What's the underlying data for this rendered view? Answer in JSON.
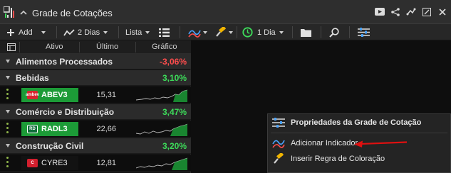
{
  "window": {
    "title": "Grade de Cotações"
  },
  "toolbar": {
    "add_label": "Add",
    "period_label": "2 Dias",
    "view_label": "Lista",
    "interval_label": "1 Dia"
  },
  "grid": {
    "columns": [
      "Ativo",
      "Último",
      "Gráfico"
    ],
    "groups": [
      {
        "name": "Alimentos Processados",
        "change": "-3,06%",
        "color": "#ff4d4d",
        "rows": []
      },
      {
        "name": "Bebidas",
        "change": "3,10%",
        "color": "#3ddc5a",
        "rows": [
          {
            "ticker": "ABEV3",
            "price": "15,31",
            "logo_text": "ambev",
            "logo_color": "#d8262f",
            "highlight": true
          }
        ]
      },
      {
        "name": "Comércio e Distribuição",
        "change": "3,47%",
        "color": "#3ddc5a",
        "rows": [
          {
            "ticker": "RADL3",
            "price": "22,66",
            "logo_text": "RD",
            "logo_color": "#0e6e3a",
            "highlight": true
          }
        ]
      },
      {
        "name": "Construção Civil",
        "change": "3,20%",
        "color": "#3ddc5a",
        "rows": [
          {
            "ticker": "CYRE3",
            "price": "12,81",
            "logo_text": "C",
            "logo_color": "#d31f2e",
            "highlight": false
          }
        ]
      }
    ]
  },
  "context_menu": {
    "items": [
      {
        "label": "Propriedades da Grade de Cotação",
        "icon": "sliders-icon",
        "bold": true
      },
      {
        "label": "Adicionar Indicador",
        "icon": "indicator-icon",
        "bold": false
      },
      {
        "label": "Inserir Regra de Coloração",
        "icon": "paint-roller-icon",
        "bold": false
      }
    ]
  },
  "colors": {
    "positive": "#3ddc5a",
    "negative": "#ff4d4d",
    "highlight_row": "#1c9b37",
    "annotation_arrow": "#e01010"
  }
}
